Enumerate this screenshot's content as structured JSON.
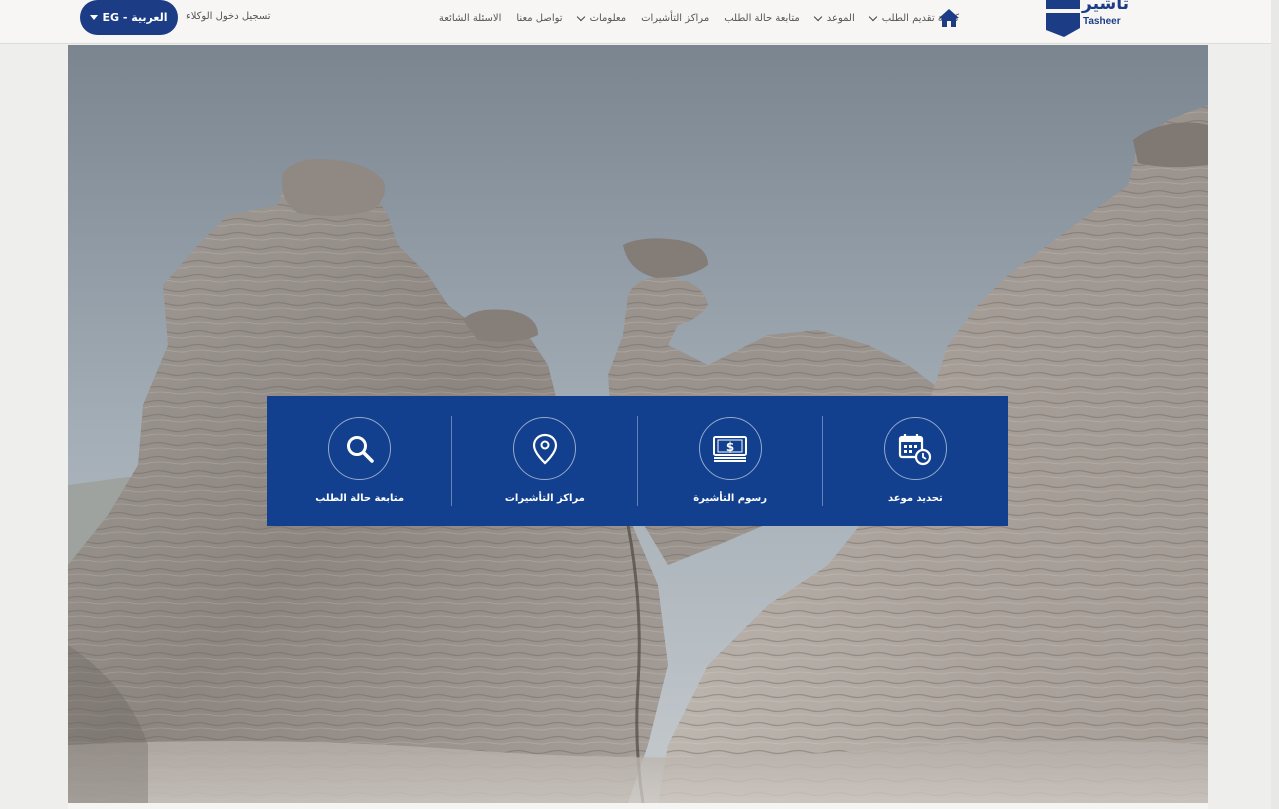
{
  "header": {
    "language_button": "EG - العربية",
    "agent_login": "تسجيل دخول الوكلاء",
    "logo": {
      "arabic": "تأشير",
      "english": "Tasheer"
    },
    "home_icon": "home-icon",
    "nav": [
      {
        "label": "كيفية تقديم الطلب",
        "dropdown": true
      },
      {
        "label": "الموعد",
        "dropdown": true
      },
      {
        "label": "متابعة حالة الطلب",
        "dropdown": false
      },
      {
        "label": "مراكز التأشيرات",
        "dropdown": false
      },
      {
        "label": "معلومات",
        "dropdown": true
      },
      {
        "label": "تواصل معنا",
        "dropdown": false
      },
      {
        "label": "الاسئلة الشائعة",
        "dropdown": false
      }
    ]
  },
  "services": [
    {
      "label": "تحديد موعد",
      "icon": "calendar-clock-icon"
    },
    {
      "label": "رسوم التأشيرة",
      "icon": "money-icon"
    },
    {
      "label": "مراكز التأشيرات",
      "icon": "location-pin-icon"
    },
    {
      "label": "متابعة حالة الطلب",
      "icon": "search-icon"
    }
  ],
  "colors": {
    "brand_blue": "#1c3d86",
    "panel_blue": "#12408e"
  }
}
